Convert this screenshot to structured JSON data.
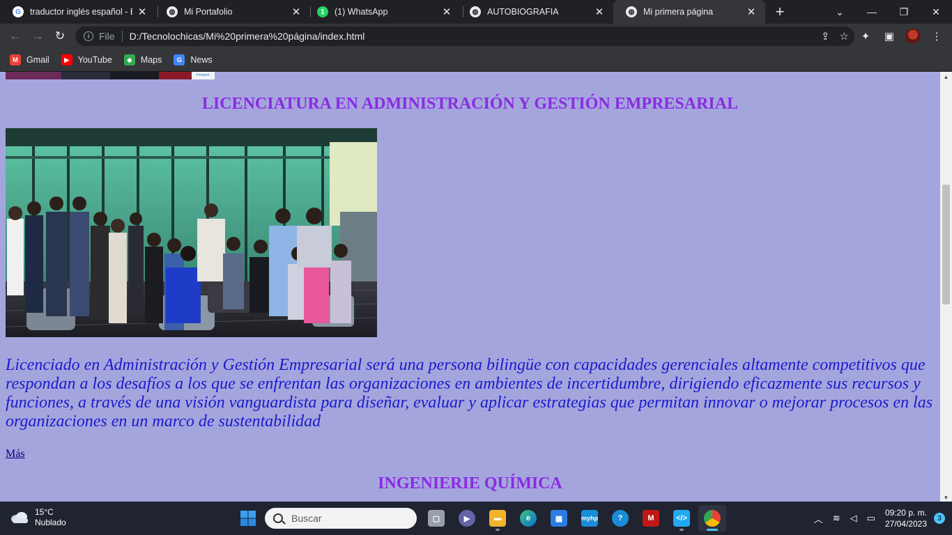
{
  "tabs": [
    {
      "title": "traductor inglés español - Bu",
      "icon": "google-icon"
    },
    {
      "title": "Mi Portafolio",
      "icon": "globe-icon"
    },
    {
      "title": "(1) WhatsApp",
      "icon": "whatsapp-icon"
    },
    {
      "title": "AUTOBIOGRAFIA",
      "icon": "globe-icon"
    },
    {
      "title": "Mi primera página",
      "icon": "globe-icon",
      "active": true
    }
  ],
  "omnibox": {
    "scheme_label": "File",
    "url": "D:/Tecnolochicas/Mi%20primera%20página/index.html"
  },
  "bookmarks": [
    {
      "label": "Gmail",
      "icon": "gmail-icon",
      "color": "#ea4335"
    },
    {
      "label": "YouTube",
      "icon": "youtube-icon",
      "color": "#ff0000"
    },
    {
      "label": "Maps",
      "icon": "maps-icon",
      "color": "#34a853"
    },
    {
      "label": "News",
      "icon": "news-icon",
      "color": "#4285f4"
    }
  ],
  "page": {
    "background": "#a5a5de",
    "heading_color": "#8a2be2",
    "text_color": "#1a1acc",
    "prev_image_caption": "Forward.",
    "heading1": "LICENCIATURA EN ADMINISTRACIÓN Y GESTIÓN EMPRESARIAL",
    "photo_alt": "group-photo",
    "description": "Licenciado en Administración y Gestión Empresarial será una persona bilingüe con capacidades gerenciales altamente competitivos que respondan a los desafíos a los que se enfrentan las organizaciones en ambientes de incertidumbre, dirigiendo eficazmente sus recursos y funciones, a través de una visión vanguardista para diseñar, evaluar y aplicar estrategias que permitan innovar o mejorar procesos en las organizaciones en un marco de sustentabilidad",
    "more_link": "Más",
    "heading2": "INGENIERIE QUÍMICA"
  },
  "taskbar": {
    "weather_temp": "15°C",
    "weather_desc": "Nublado",
    "search_placeholder": "Buscar",
    "time": "09:20 p. m.",
    "date": "27/04/2023",
    "notifications": "3",
    "apps": [
      {
        "name": "start-button",
        "color": "#3a8ee6"
      },
      {
        "name": "search-box"
      },
      {
        "name": "task-view-icon",
        "color": "#b0b0b0"
      },
      {
        "name": "teams-chat-icon",
        "color": "#6264a7"
      },
      {
        "name": "file-explorer-icon",
        "color": "#f2b42b"
      },
      {
        "name": "edge-icon",
        "color": "#0f8fd6"
      },
      {
        "name": "store-icon",
        "color": "#2a7de1"
      },
      {
        "name": "myhp-icon",
        "color": "#1a8cd8"
      },
      {
        "name": "help-icon",
        "color": "#1a8cd8"
      },
      {
        "name": "mcafee-icon",
        "color": "#c01818"
      },
      {
        "name": "vscode-icon",
        "color": "#23a9f2"
      },
      {
        "name": "chrome-icon",
        "color": "#e0a52a"
      }
    ]
  }
}
